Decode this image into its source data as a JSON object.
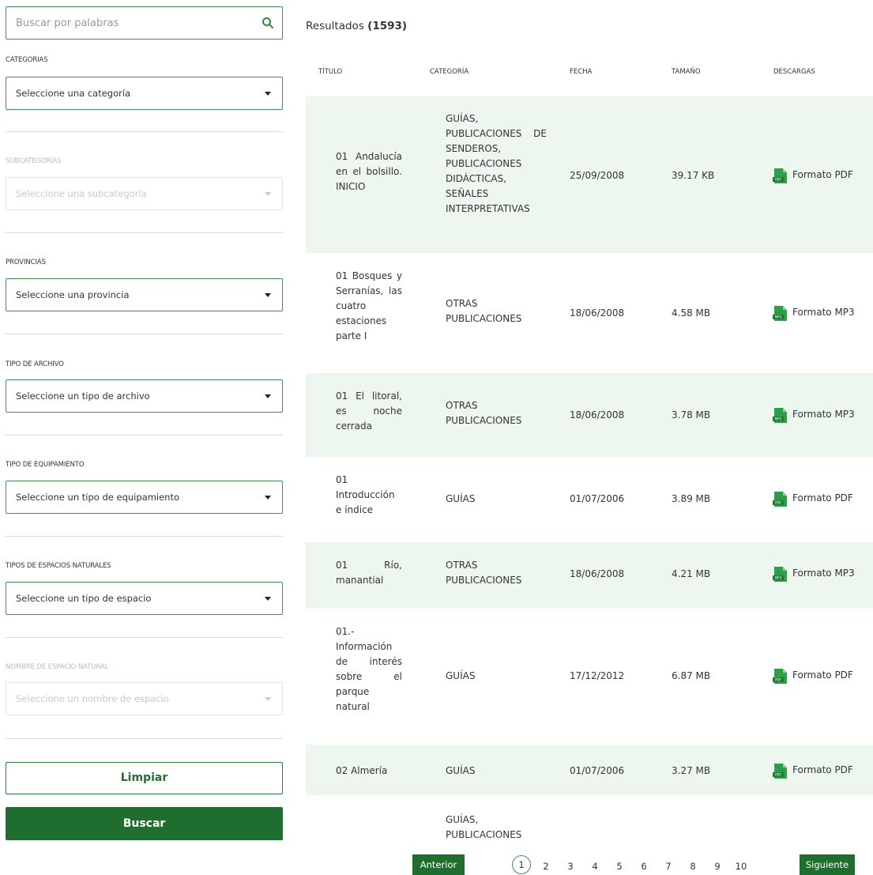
{
  "search": {
    "placeholder": "Buscar por palabras",
    "icon": "search-icon"
  },
  "filters": [
    {
      "label": "CATEGORIAS",
      "placeholder": "Seleccione una categoría",
      "disabled": false
    },
    {
      "label": "SUBCATEGORÍAS",
      "placeholder": "Seleccione una subcategoría",
      "disabled": true
    },
    {
      "label": "PROVINCIAS",
      "placeholder": "Seleccione una provincia",
      "disabled": false
    },
    {
      "label": "TIPO DE ARCHIVO",
      "placeholder": "Seleccione un tipo de archivo",
      "disabled": false
    },
    {
      "label": "TIPO DE EQUIPAMIENTO",
      "placeholder": "Seleccione un tipo de equipamiento",
      "disabled": false
    },
    {
      "label": "TIPOS DE ESPACIOS NATURALES",
      "placeholder": "Seleccione un tipo de espacio",
      "disabled": false
    },
    {
      "label": "NOMBRE DE ESPACIO NATURAL",
      "placeholder": "Seleccione un nombre de espacio",
      "disabled": true
    }
  ],
  "buttons": {
    "clear": "Limpiar",
    "search": "Buscar"
  },
  "results": {
    "label": "Resultados",
    "count": "(1593)",
    "columns": [
      "TÍTULO",
      "CATEGORÍA",
      "FECHA",
      "TAMAÑO",
      "DESCARGAS"
    ],
    "rows": [
      {
        "title": "01 Andalucía en el bolsillo. INICIO",
        "category": "GUÍAS, PUBLICACIONES DE SENDEROS, PUBLICACIONES DIDÁCTICAS, SEÑALES INTERPRETATIVAS",
        "date": "25/09/2008",
        "size": "39.17 KB",
        "download": "Formato PDF"
      },
      {
        "title": "01 Bosques y Serranías, las cuatro estaciones parte I",
        "category": "OTRAS PUBLICACIONES",
        "date": "18/06/2008",
        "size": "4.58 MB",
        "download": "Formato MP3"
      },
      {
        "title": "01 El litoral, es noche cerrada",
        "category": "OTRAS PUBLICACIONES",
        "date": "18/06/2008",
        "size": "3.78 MB",
        "download": "Formato MP3"
      },
      {
        "title": "01 Introducción e índice",
        "category": "GUÍAS",
        "date": "01/07/2006",
        "size": "3.89 MB",
        "download": "Formato PDF"
      },
      {
        "title": "01 Río, manantial",
        "category": "OTRAS PUBLICACIONES",
        "date": "18/06/2008",
        "size": "4.21 MB",
        "download": "Formato MP3"
      },
      {
        "title": "01.- Información de interés sobre el parque natural",
        "category": "GUÍAS",
        "date": "17/12/2012",
        "size": "6.87 MB",
        "download": "Formato PDF"
      },
      {
        "title": "02 Almería",
        "category": "GUÍAS",
        "date": "01/07/2006",
        "size": "3.27 MB",
        "download": "Formato PDF"
      },
      {
        "title": "",
        "category": "GUÍAS, PUBLICACIONES",
        "date": "",
        "size": "",
        "download": ""
      }
    ]
  },
  "pagination": {
    "prev": "Anterior",
    "next": "Siguiente",
    "pages": [
      "1",
      "2",
      "3",
      "4",
      "5",
      "6",
      "7",
      "8",
      "9",
      "10"
    ],
    "current": "1"
  },
  "colors": {
    "accent": "#1f6e2f",
    "border": "#3f9152",
    "row_shade": "#eef6f0"
  }
}
